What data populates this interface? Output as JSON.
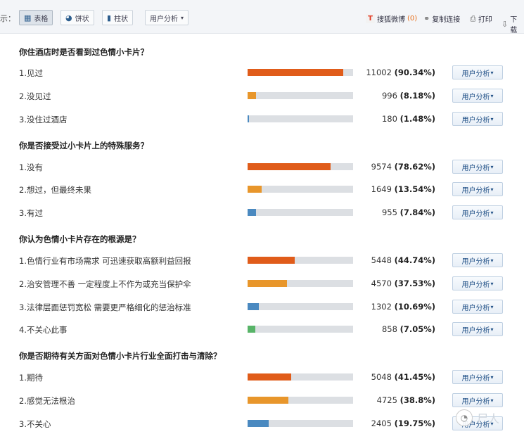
{
  "toolbar": {
    "prefix": "示：",
    "view_table": "表格",
    "view_pie": "饼状",
    "view_bar": "柱状",
    "user_analysis": "用户分析",
    "weibo_label": "搜狐微博",
    "weibo_count": "(0)",
    "copy_link": "复制连接",
    "print": "打印",
    "download": "下载"
  },
  "colors": {
    "orange": "#e05c1a",
    "amber": "#e8962b",
    "blue": "#4a89c0",
    "green": "#58b468",
    "track": "#dcdfe3"
  },
  "questions": [
    {
      "title": "你住酒店时是否看到过色情小卡片？",
      "options": [
        {
          "label": "1.见过",
          "count": "11002",
          "pct": "(90.34%)",
          "fraction": 0.9034,
          "color": "#e05c1a"
        },
        {
          "label": "2.没见过",
          "count": "996",
          "pct": "(8.18%)",
          "fraction": 0.0818,
          "color": "#e8962b"
        },
        {
          "label": "3.没住过酒店",
          "count": "180",
          "pct": "(1.48%)",
          "fraction": 0.0148,
          "color": "#4a89c0"
        }
      ]
    },
    {
      "title": "你是否接受过小卡片上的特殊服务？",
      "options": [
        {
          "label": "1.没有",
          "count": "9574",
          "pct": "(78.62%)",
          "fraction": 0.7862,
          "color": "#e05c1a"
        },
        {
          "label": "2.想过，但最终未果",
          "count": "1649",
          "pct": "(13.54%)",
          "fraction": 0.1354,
          "color": "#e8962b"
        },
        {
          "label": "3.有过",
          "count": "955",
          "pct": "(7.84%)",
          "fraction": 0.0784,
          "color": "#4a89c0"
        }
      ]
    },
    {
      "title": "你认为色情小卡片存在的根源是？",
      "options": [
        {
          "label": "1.色情行业有市场需求 可迅速获取高额利益回报",
          "count": "5448",
          "pct": "(44.74%)",
          "fraction": 0.4474,
          "color": "#e05c1a"
        },
        {
          "label": "2.治安管理不善 一定程度上不作为或充当保护伞",
          "count": "4570",
          "pct": "(37.53%)",
          "fraction": 0.3753,
          "color": "#e8962b"
        },
        {
          "label": "3.法律层面惩罚宽松 需要更严格细化的惩治标准",
          "count": "1302",
          "pct": "(10.69%)",
          "fraction": 0.1069,
          "color": "#4a89c0"
        },
        {
          "label": "4.不关心此事",
          "count": "858",
          "pct": "(7.05%)",
          "fraction": 0.0705,
          "color": "#58b468"
        }
      ]
    },
    {
      "title": "你是否期待有关方面对色情小卡片行业全面打击与清除？",
      "options": [
        {
          "label": "1.期待",
          "count": "5048",
          "pct": "(41.45%)",
          "fraction": 0.4145,
          "color": "#e05c1a"
        },
        {
          "label": "2.感觉无法根治",
          "count": "4725",
          "pct": "(38.8%)",
          "fraction": 0.388,
          "color": "#e8962b"
        },
        {
          "label": "3.不关心",
          "count": "2405",
          "pct": "(19.75%)",
          "fraction": 0.1975,
          "color": "#4a89c0"
        }
      ]
    }
  ],
  "row_button_label": "用户分析",
  "watermark": {
    "text": "尸人"
  }
}
